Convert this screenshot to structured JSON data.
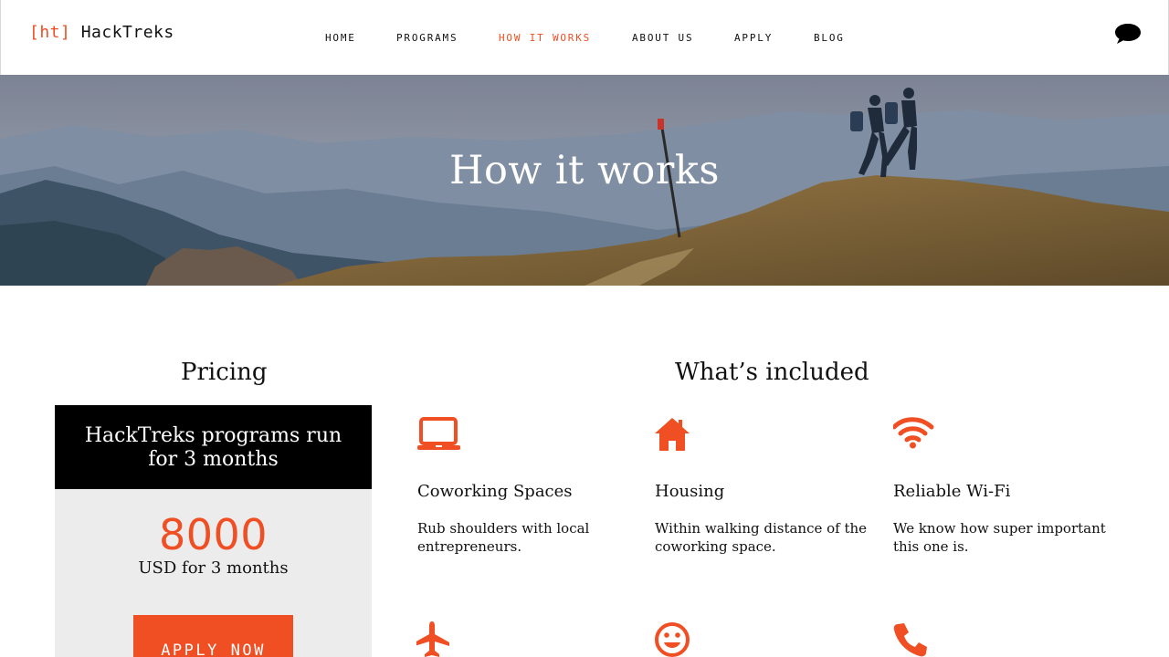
{
  "brand": {
    "bracket_open": "[ht]",
    "name": "HackTreks"
  },
  "nav": {
    "items": [
      {
        "label": "HOME",
        "active": false
      },
      {
        "label": "PROGRAMS",
        "active": false
      },
      {
        "label": "HOW IT WORKS",
        "active": true
      },
      {
        "label": "ABOUT US",
        "active": false
      },
      {
        "label": "APPLY",
        "active": false
      },
      {
        "label": "BLOG",
        "active": false
      }
    ],
    "chat_icon": "chat-bubble-icon"
  },
  "hero": {
    "title": "How it works"
  },
  "pricing": {
    "title": "Pricing",
    "headline": "HackTreks programs run for 3 months",
    "price": "8000",
    "price_note": "USD for 3 months",
    "cta": "APPLY NOW"
  },
  "included": {
    "title": "What’s included",
    "features": [
      {
        "icon": "laptop-icon",
        "title": "Coworking Spaces",
        "text": "Rub shoulders with local entrepreneurs."
      },
      {
        "icon": "house-icon",
        "title": "Housing",
        "text": "Within walking distance of the coworking space."
      },
      {
        "icon": "wifi-icon",
        "title": "Reliable Wi-Fi",
        "text": "We know how super important this one is."
      },
      {
        "icon": "airplane-icon"
      },
      {
        "icon": "smiley-icon"
      },
      {
        "icon": "phone-icon"
      }
    ]
  },
  "colors": {
    "accent": "#f04e23",
    "dark": "#000000",
    "panel": "#ececec"
  }
}
